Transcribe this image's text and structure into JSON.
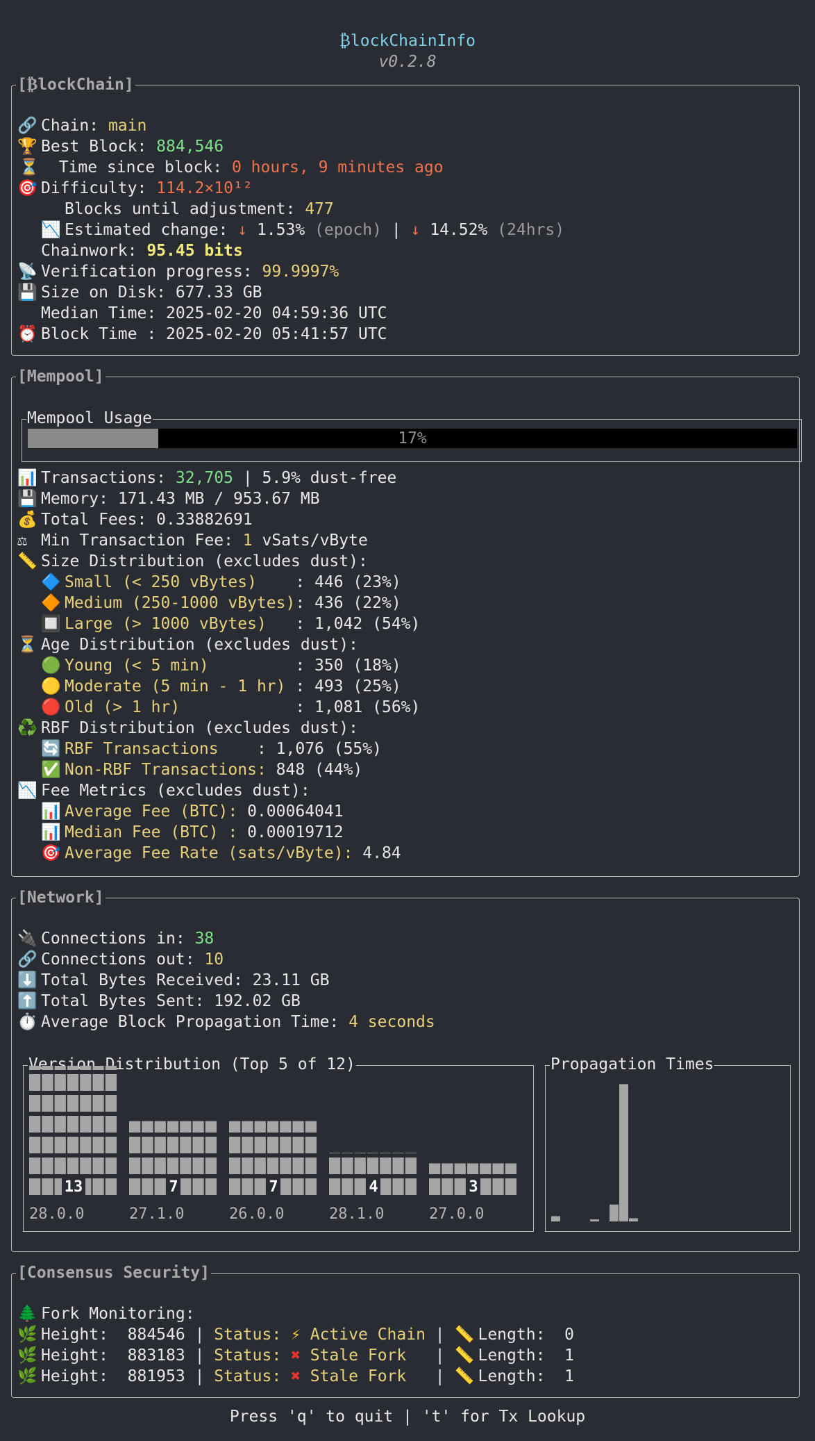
{
  "app": {
    "title": "₿lockChainInfo",
    "version": "v0.2.8"
  },
  "blockchain": {
    "panel_title": "[₿lockChain]",
    "chain_label": "Chain: ",
    "chain": "main",
    "best_block_label": "Best Block: ",
    "best_block": "884,546",
    "time_since_label": "Time since block: ",
    "time_since": "0 hours, 9 minutes ago",
    "difficulty_label": "Difficulty: ",
    "difficulty": "114.2×10¹²",
    "blocks_until_label": "Blocks until adjustment: ",
    "blocks_until": "477",
    "est_change_label": "Estimated change: ",
    "est_arrow_1": "↓ ",
    "est_epoch": "1.53%",
    "est_epoch_tag": " (epoch)",
    "est_sep": " | ",
    "est_arrow_2": "↓ ",
    "est_24h": "14.52%",
    "est_24h_tag": " (24hrs)",
    "chainwork_label": "Chainwork: ",
    "chainwork": "95.45 bits",
    "verification_label": "Verification progress: ",
    "verification": "99.9997%",
    "size_label": "Size on Disk: ",
    "size": "677.33 GB",
    "median_label": "Median Time: ",
    "median": "2025-02-20 04:59:36 UTC",
    "block_time_label": "Block Time : ",
    "block_time": "2025-02-20 05:41:57 UTC"
  },
  "mempool": {
    "panel_title": "[Mempool]",
    "usage_title": "Mempool Usage",
    "usage_label": "17%",
    "usage_fraction": 0.17,
    "tx_label": "Transactions: ",
    "tx": "32,705",
    "tx_suffix": " | 5.9% dust-free",
    "memory_label": "Memory: ",
    "memory": "171.43 MB / 953.67 MB",
    "fees_label": "Total Fees: ",
    "fees": "0.33882691",
    "min_fee_label": "Min Transaction Fee: ",
    "min_fee": "1",
    "min_fee_unit": " vSats/vByte",
    "size_dist_label": "Size Distribution (excludes dust):",
    "small_label": "Small (< 250 vBytes)    ",
    "small_value": ": 446 (23%)",
    "medium_label": "Medium (250-1000 vBytes)",
    "medium_value": ": 436 (22%)",
    "large_label": "Large (> 1000 vBytes)   ",
    "large_value": ": 1,042 (54%)",
    "age_dist_label": "Age Distribution (excludes dust):",
    "young_label": "Young (< 5 min)         ",
    "young_value": ": 350 (18%)",
    "moderate_label": "Moderate (5 min - 1 hr) ",
    "moderate_value": ": 493 (25%)",
    "old_label": "Old (> 1 hr)            ",
    "old_value": ": 1,081 (56%)",
    "rbf_dist_label": "RBF Distribution (excludes dust):",
    "rbf_label": "RBF Transactions    ",
    "rbf_value": ": 1,076 (55%)",
    "nonrbf_label": "Non-RBF Transactions: ",
    "nonrbf_value": "848 (44%)",
    "fee_metrics_label": "Fee Metrics (excludes dust):",
    "avg_fee_label": "Average Fee (BTC): ",
    "avg_fee": "0.00064041",
    "median_fee_label": "Median Fee (BTC) : ",
    "median_fee": "0.00019712",
    "avg_rate_label": "Average Fee Rate (sats/vByte): ",
    "avg_rate": "4.84"
  },
  "network": {
    "panel_title": "[Network]",
    "conn_in_label": "Connections in: ",
    "conn_in": "38",
    "conn_out_label": "Connections out: ",
    "conn_out": "10",
    "recv_label": "Total Bytes Received: ",
    "recv": "23.11 GB",
    "sent_label": "Total Bytes Sent: ",
    "sent": "192.02 GB",
    "prop_label": "Average Block Propagation Time: ",
    "prop": "4 seconds",
    "version_title": "Version Distribution (Top 5 of 12)",
    "propagation_title": "Propagation Times"
  },
  "chart_data": [
    {
      "type": "bar",
      "title": "Version Distribution (Top 5 of 12)",
      "categories": [
        "28.0.0",
        "27.1.0",
        "26.0.0",
        "28.1.0",
        "27.0.0"
      ],
      "values": [
        13,
        7,
        7,
        4,
        3
      ],
      "ylim": [
        0,
        13
      ]
    },
    {
      "type": "bar",
      "title": "Propagation Times",
      "values": [
        0.5,
        0,
        0,
        0,
        0.2,
        0,
        1.6,
        13,
        0.3
      ],
      "ylim": [
        0,
        13
      ]
    }
  ],
  "consensus": {
    "panel_title": "[Consensus Security]",
    "fork_label": "Fork Monitoring:",
    "forks": [
      {
        "height_label": "Height:  ",
        "height": "884546",
        "status_label": "Status: ",
        "status_icon": "⚡",
        "status": "Active Chain",
        "length_label": "Length:  ",
        "length": "0"
      },
      {
        "height_label": "Height:  ",
        "height": "883183",
        "status_label": "Status: ",
        "status_icon": "✖",
        "status": "Stale Fork  ",
        "length_label": "Length:  ",
        "length": "1"
      },
      {
        "height_label": "Height:  ",
        "height": "881953",
        "status_label": "Status: ",
        "status_icon": "✖",
        "status": "Stale Fork  ",
        "length_label": "Length:  ",
        "length": "1"
      }
    ]
  },
  "footer": {
    "text": "Press 'q' to quit | 't' for Tx Lookup"
  },
  "icons": {
    "chain": "🔗",
    "trophy": "🏆",
    "hourglass": "⏳",
    "target": "🎯",
    "chart_down": "📉",
    "satellite": "📡",
    "disk": "💾",
    "alarm": "⏰",
    "bar_chart": "📊",
    "money": "💰",
    "scale": "⚖",
    "ruler": "📏",
    "blue_diamond": "🔷",
    "orange_diamond": "🔶",
    "black_square": "🔲",
    "green_circle": "🟢",
    "yellow_circle": "🟡",
    "red_circle": "🔴",
    "recycle": "♻️",
    "refresh": "🔄",
    "check": "✅",
    "plug": "🔌",
    "down_arrow": "⬇️",
    "up_arrow": "⬆️",
    "stopwatch": "⏱️",
    "tree": "🌲",
    "hops": "🌿",
    "ruler2": "📏"
  }
}
